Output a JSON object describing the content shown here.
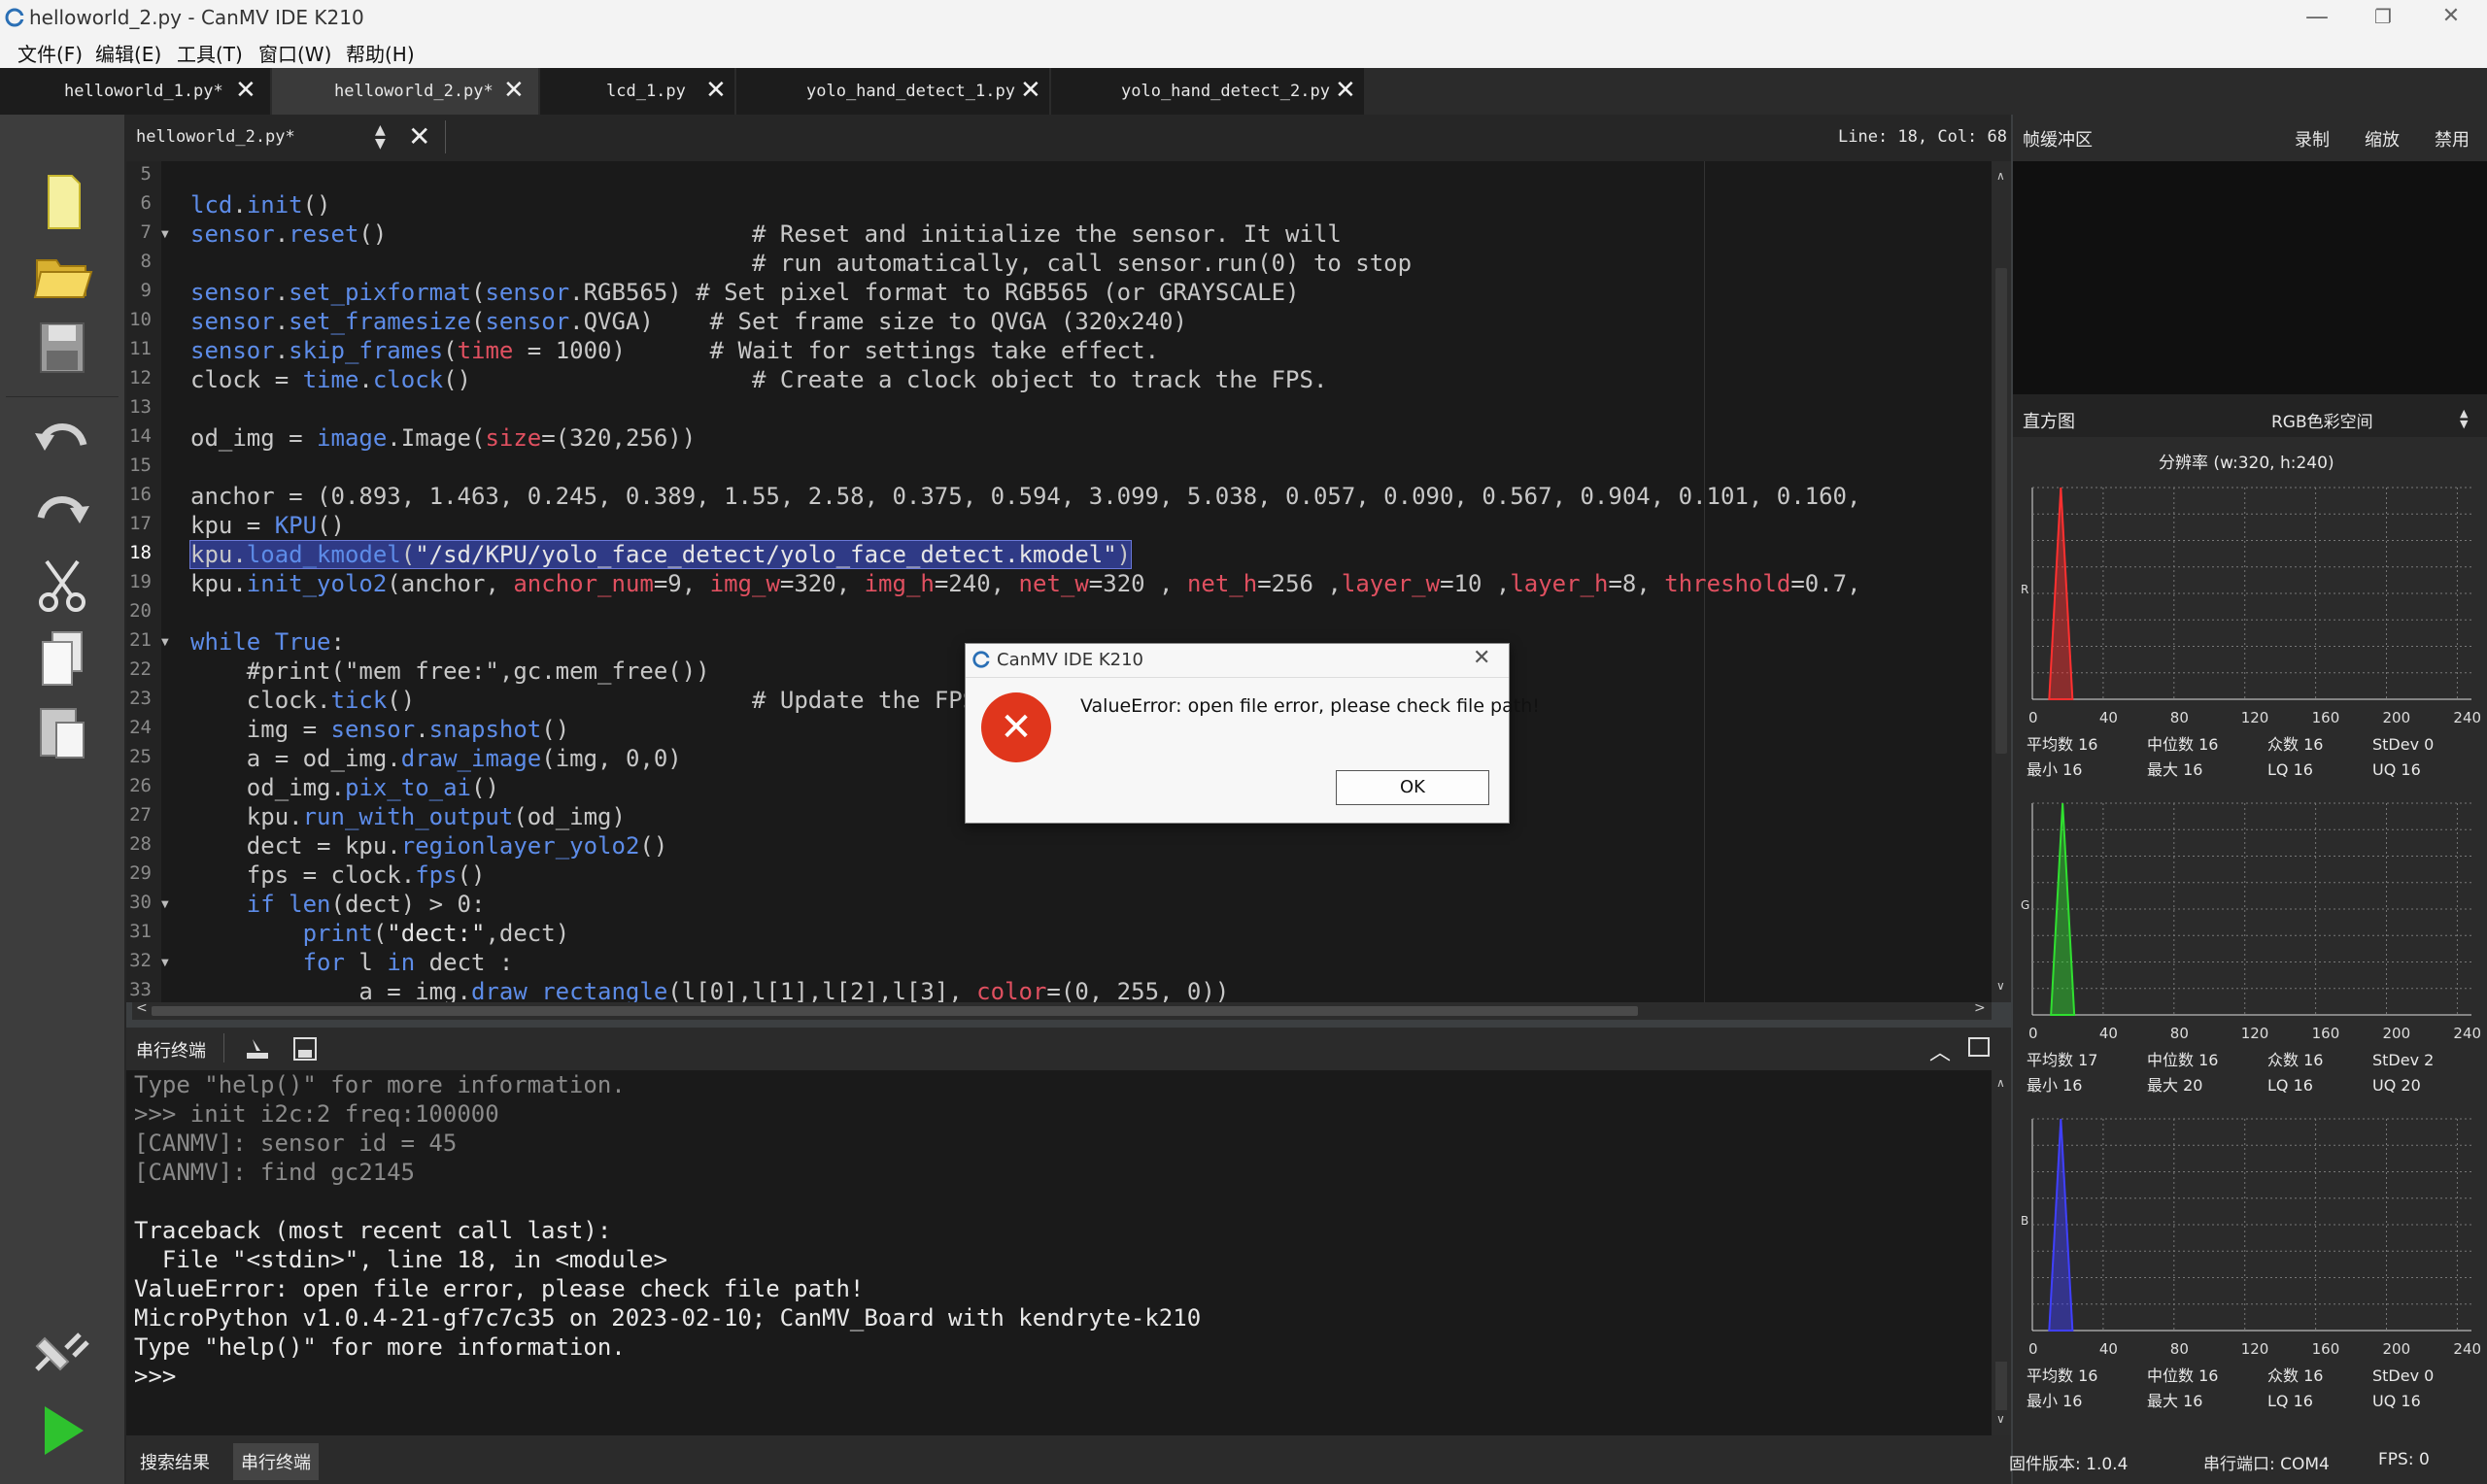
{
  "window": {
    "title": "helloworld_2.py - CanMV IDE K210",
    "minimize_glyph": "—",
    "maximize_glyph": "❐",
    "close_glyph": "✕"
  },
  "menubar": [
    "文件(F)",
    "编辑(E)",
    "工具(T)",
    "窗口(W)",
    "帮助(H)"
  ],
  "tabs": [
    {
      "label": "helloworld_1.py*",
      "active": false
    },
    {
      "label": "helloworld_2.py*",
      "active": true
    },
    {
      "label": "lcd_1.py",
      "active": false
    },
    {
      "label": "yolo_hand_detect_1.py",
      "active": false
    },
    {
      "label": "yolo_hand_detect_2.py",
      "active": false
    }
  ],
  "editor": {
    "current_file": "helloworld_2.py*",
    "position": "Line: 18, Col: 68",
    "line_numbers": [
      "5",
      "6",
      "7",
      "8",
      "9",
      "10",
      "11",
      "12",
      "13",
      "14",
      "15",
      "16",
      "17",
      "18",
      "19",
      "20",
      "21",
      "22",
      "23",
      "24",
      "25",
      "26",
      "27",
      "28",
      "29",
      "30",
      "31",
      "32",
      "33"
    ],
    "highlight_line_index": 13
  },
  "code": [
    "",
    "lcd.init()",
    "sensor.reset()                          # Reset and initialize the sensor. It will",
    "                                        # run automatically, call sensor.run(0) to stop",
    "sensor.set_pixformat(sensor.RGB565) # Set pixel format to RGB565 (or GRAYSCALE)",
    "sensor.set_framesize(sensor.QVGA)    # Set frame size to QVGA (320x240)",
    "sensor.skip_frames(time = 1000)      # Wait for settings take effect.",
    "clock = time.clock()                    # Create a clock object to track the FPS.",
    "",
    "od_img = image.Image(size=(320,256))",
    "",
    "anchor = (0.893, 1.463, 0.245, 0.389, 1.55, 2.58, 0.375, 0.594, 3.099, 5.038, 0.057, 0.090, 0.567, 0.904, 0.101, 0.160,",
    "kpu = KPU()",
    "kpu.load_kmodel(\"/sd/KPU/yolo_face_detect/yolo_face_detect.kmodel\")",
    "kpu.init_yolo2(anchor, anchor_num=9, img_w=320, img_h=240, net_w=320 , net_h=256 ,layer_w=10 ,layer_h=8, threshold=0.7,",
    "",
    "while True:",
    "    #print(\"mem free:\",gc.mem_free())",
    "    clock.tick()                        # Update the FPS clock.",
    "    img = sensor.snapshot()",
    "    a = od_img.draw_image(img, 0,0)",
    "    od_img.pix_to_ai()",
    "    kpu.run_with_output(od_img)",
    "    dect = kpu.regionlayer_yolo2()",
    "    fps = clock.fps()",
    "    if len(dect) > 0:",
    "        print(\"dect:\",dect)",
    "        for l in dect :",
    "            a = img.draw_rectangle(l[0],l[1],l[2],l[3], color=(0, 255, 0))"
  ],
  "terminal": {
    "title": "串行终端",
    "lines": [
      "Type \"help()\" for more information.",
      ">>> init i2c:2 freq:100000",
      "[CANMV]: sensor id = 45",
      "[CANMV]: find gc2145",
      "",
      "Traceback (most recent call last):",
      "  File \"<stdin>\", line 18, in <module>",
      "ValueError: open file error, please check file path!",
      "MicroPython v1.0.4-21-gf7c7c35 on 2023-02-10; CanMV_Board with kendryte-k210",
      "Type \"help()\" for more information.",
      ">>>"
    ]
  },
  "bottom_tabs": [
    "搜索结果",
    "串行终端"
  ],
  "frame_buffer": {
    "title": "帧缓冲区",
    "record": "录制",
    "zoom": "缩放",
    "disable": "禁用"
  },
  "histogram": {
    "title": "直方图",
    "colorspace": "RGB色彩空间",
    "resolution": "分辨率 (w:320, h:240)",
    "x_ticks": [
      "0",
      "40",
      "80",
      "120",
      "160",
      "200",
      "240"
    ],
    "channels": [
      {
        "label": "R",
        "color": "#ff3030",
        "mean": "16",
        "median": "16",
        "mode": "16",
        "stdev": "0",
        "min": "16",
        "max": "16",
        "lq": "16",
        "uq": "16"
      },
      {
        "label": "G",
        "color": "#30e030",
        "mean": "17",
        "median": "16",
        "mode": "16",
        "stdev": "2",
        "min": "16",
        "max": "20",
        "lq": "16",
        "uq": "20"
      },
      {
        "label": "B",
        "color": "#4040ff",
        "mean": "16",
        "median": "16",
        "mode": "16",
        "stdev": "0",
        "min": "16",
        "max": "16",
        "lq": "16",
        "uq": "16"
      }
    ],
    "stat_labels": {
      "mean": "平均数",
      "median": "中位数",
      "mode": "众数",
      "stdev": "StDev",
      "min": "最小",
      "max": "最大",
      "lq": "LQ",
      "uq": "UQ"
    }
  },
  "status": {
    "firmware": "固件版本: 1.0.4",
    "port": "串行端口: COM4",
    "fps": "FPS: 0"
  },
  "dialog": {
    "title": "CanMV IDE K210",
    "message": "ValueError: open file error, please check file path!",
    "ok_label": "OK",
    "close_glyph": "✕",
    "error_glyph": "✕"
  },
  "colors": {
    "keyword": "#5d8ce8",
    "string": "#e8e8e8",
    "comment": "#c8c8c8",
    "param": "#e05060",
    "accent_green": "#2ec22e"
  }
}
